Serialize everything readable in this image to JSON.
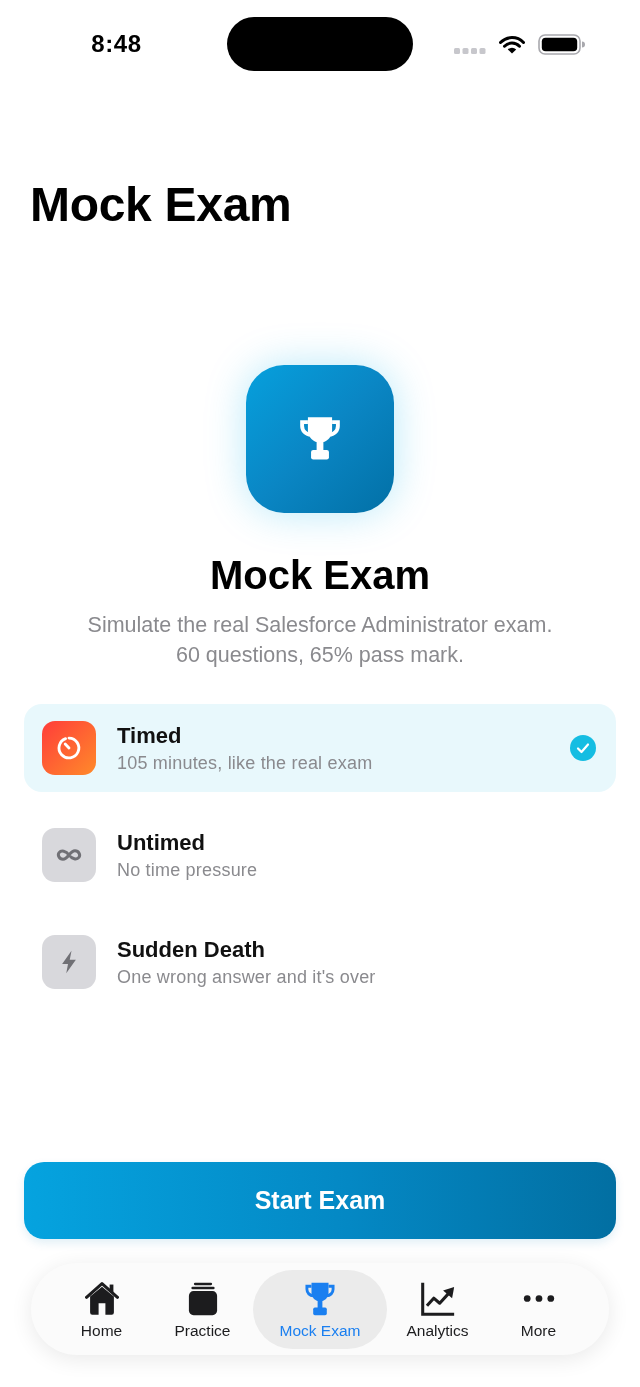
{
  "status_bar": {
    "time": "8:48"
  },
  "header": {
    "title": "Mock Exam"
  },
  "hero": {
    "title": "Mock Exam",
    "description": "Simulate the real Salesforce Administrator exam. 60 questions, 65% pass mark."
  },
  "options": [
    {
      "title": "Timed",
      "subtitle": "105 minutes, like the real exam",
      "selected": true
    },
    {
      "title": "Untimed",
      "subtitle": "No time pressure",
      "selected": false
    },
    {
      "title": "Sudden Death",
      "subtitle": "One wrong answer and it's over",
      "selected": false
    }
  ],
  "start_button": {
    "label": "Start Exam"
  },
  "tab_bar": {
    "tabs": [
      {
        "label": "Home",
        "selected": false
      },
      {
        "label": "Practice",
        "selected": false
      },
      {
        "label": "Mock Exam",
        "selected": true
      },
      {
        "label": "Analytics",
        "selected": false
      },
      {
        "label": "More",
        "selected": false
      }
    ]
  }
}
